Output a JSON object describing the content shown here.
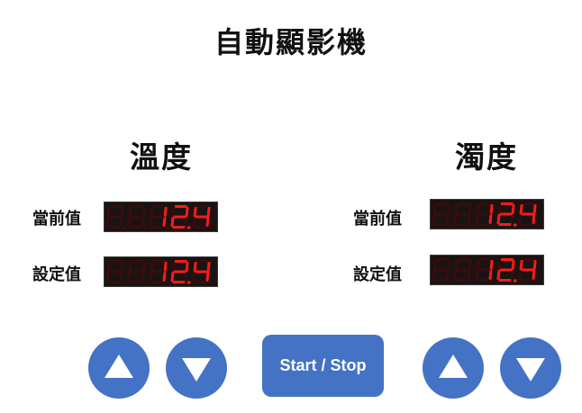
{
  "app": {
    "title": "自動顯影機"
  },
  "temperature": {
    "title": "溫度",
    "current_label": "當前值",
    "current_value": "12.4",
    "setpoint_label": "設定值",
    "setpoint_value": "12.4"
  },
  "turbidity": {
    "title": "濁度",
    "current_label": "當前值",
    "current_value": "12.4",
    "setpoint_label": "設定值",
    "setpoint_value": "12.4"
  },
  "controls": {
    "start_stop_label": "Start / Stop",
    "left_up_icon": "triangle-up-icon",
    "left_down_icon": "triangle-down-icon",
    "right_up_icon": "triangle-up-icon",
    "right_down_icon": "triangle-down-icon"
  },
  "colors": {
    "button_blue": "#4472c4",
    "segment_on": "#ff1a1a",
    "segment_off": "#3a0c0c",
    "display_bg": "#1a1313"
  }
}
